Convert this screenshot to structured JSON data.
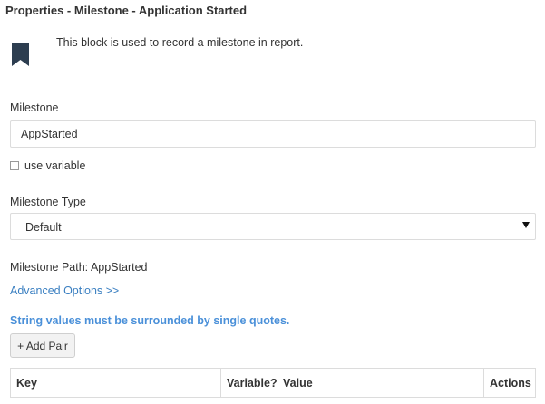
{
  "panel": {
    "title": "Properties - Milestone - Application Started",
    "description": "This block is used to record a milestone in report.",
    "icon": "bookmark-icon"
  },
  "milestone": {
    "label": "Milestone",
    "value": "AppStarted",
    "use_variable_label": "use variable",
    "use_variable_checked": false
  },
  "milestone_type": {
    "label": "Milestone Type",
    "selected": "Default"
  },
  "milestone_path": "Milestone Path: AppStarted",
  "advanced_options_link": "Advanced Options >>",
  "info_text": "String values must be surrounded by single quotes.",
  "add_pair_label": "+ Add Pair",
  "pairs_table": {
    "headers": [
      "Key",
      "Variable?",
      "Value",
      "Actions"
    ]
  },
  "colors": {
    "link": "#3a7fc1",
    "info": "#4a90d9",
    "icon": "#2d3e50"
  }
}
